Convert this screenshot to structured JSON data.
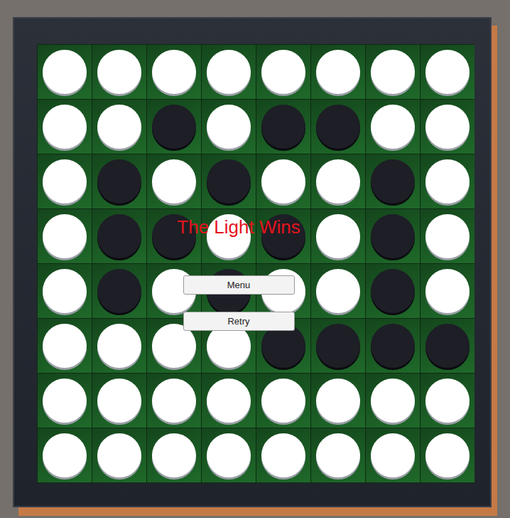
{
  "result": {
    "title": "The Light Wins"
  },
  "buttons": [
    {
      "label": "Menu"
    },
    {
      "label": "Retry"
    }
  ],
  "board": {
    "rows": [
      [
        "white",
        "white",
        "white",
        "white",
        "white",
        "white",
        "white",
        "white"
      ],
      [
        "white",
        "white",
        "black",
        "white",
        "black",
        "black",
        "white",
        "white"
      ],
      [
        "white",
        "black",
        "white",
        "black",
        "white",
        "white",
        "black",
        "white"
      ],
      [
        "white",
        "black",
        "black",
        "white",
        "black",
        "white",
        "black",
        "white"
      ],
      [
        "white",
        "black",
        "white",
        "black",
        "white",
        "white",
        "black",
        "white"
      ],
      [
        "white",
        "white",
        "white",
        "white",
        "black",
        "black",
        "black",
        "black"
      ],
      [
        "white",
        "white",
        "white",
        "white",
        "white",
        "white",
        "white",
        "white"
      ],
      [
        "white",
        "white",
        "white",
        "white",
        "white",
        "white",
        "white",
        "white"
      ]
    ]
  }
}
